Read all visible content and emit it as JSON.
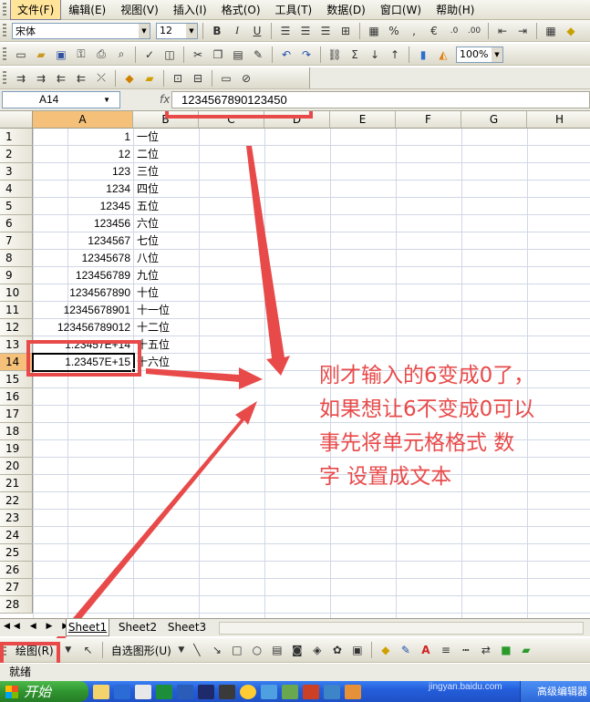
{
  "menu": [
    "文件(F)",
    "编辑(E)",
    "视图(V)",
    "插入(I)",
    "格式(O)",
    "工具(T)",
    "数据(D)",
    "窗口(W)",
    "帮助(H)"
  ],
  "format_bar": {
    "font_name": "宋体",
    "font_size": "12",
    "percent": "%",
    "currency": "€",
    "bold": "B",
    "italic": "I",
    "underline": "U"
  },
  "standard_bar": {
    "zoom": "100%",
    "sigma": "Σ"
  },
  "name_box": "A14",
  "formula_value": "1234567890123450",
  "columns": [
    "A",
    "B",
    "C",
    "D",
    "E",
    "F",
    "G",
    "H"
  ],
  "row_numbers": [
    "1",
    "2",
    "3",
    "4",
    "5",
    "6",
    "7",
    "8",
    "9",
    "10",
    "11",
    "12",
    "13",
    "14",
    "15",
    "16",
    "17",
    "18",
    "19",
    "20",
    "21",
    "22",
    "23",
    "24",
    "25",
    "26",
    "27",
    "28"
  ],
  "col_a": [
    "1",
    "12",
    "123",
    "1234",
    "12345",
    "123456",
    "1234567",
    "12345678",
    "123456789",
    "1234567890",
    "12345678901",
    "123456789012",
    "1.23457E+14",
    "1.23457E+15"
  ],
  "col_b": [
    "一位",
    "二位",
    "三位",
    "四位",
    "五位",
    "六位",
    "七位",
    "八位",
    "九位",
    "十位",
    "十一位",
    "十二位",
    "十五位",
    "十六位"
  ],
  "annotation": [
    "刚才输入的6变成0了，",
    "如果想让6不变成0可以",
    "事先将单元格格式 数",
    "字 设置成文本"
  ],
  "sheet_tabs": [
    "Sheet1",
    "Sheet2",
    "Sheet3"
  ],
  "drawing_bar": {
    "draw_label": "绘图(R)",
    "autoshapes_label": "自选图形(U)"
  },
  "status": "就绪",
  "taskbar": {
    "start": "开始",
    "tray_text": "高级编辑器",
    "watermark": "jingyan.baidu.com"
  },
  "colors": {
    "annotation_red": "#e84a4a",
    "selection_orange": "#f5c17a",
    "xp_blue": "#245edb",
    "xp_green": "#2f952f"
  }
}
